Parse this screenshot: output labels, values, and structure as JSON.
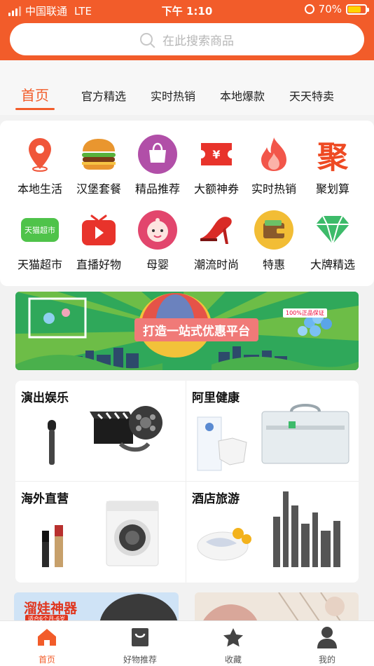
{
  "status_bar": {
    "carrier": "中国联通",
    "network": "LTE",
    "time": "下午 1:10",
    "battery": "70%"
  },
  "search": {
    "placeholder": "在此搜索商品"
  },
  "tabs": [
    {
      "label": "首页",
      "active": true
    },
    {
      "label": "官方精选"
    },
    {
      "label": "实时热销"
    },
    {
      "label": "本地爆款"
    },
    {
      "label": "天天特卖"
    }
  ],
  "categories": [
    {
      "label": "本地生活",
      "icon": "location-pin-icon"
    },
    {
      "label": "汉堡套餐",
      "icon": "burger-icon"
    },
    {
      "label": "精品推荐",
      "icon": "shopping-bag-icon"
    },
    {
      "label": "大额神券",
      "icon": "coupon-icon"
    },
    {
      "label": "实时热销",
      "icon": "flame-icon"
    },
    {
      "label": "聚划算",
      "icon": "juhuasuan-icon"
    },
    {
      "label": "天猫超市",
      "icon": "tmall-supermarket-icon",
      "inner": "天猫超市"
    },
    {
      "label": "直播好物",
      "icon": "live-play-icon"
    },
    {
      "label": "母婴",
      "icon": "baby-icon"
    },
    {
      "label": "潮流时尚",
      "icon": "high-heel-icon"
    },
    {
      "label": "特惠",
      "icon": "wallet-icon"
    },
    {
      "label": "大牌精选",
      "icon": "diamond-icon"
    }
  ],
  "juhuasuan_glyph": "聚",
  "banner": {
    "title": "打造一站式优惠平台",
    "badge": "100%正品保证"
  },
  "features": [
    {
      "title": "演出娱乐"
    },
    {
      "title": "阿里健康"
    },
    {
      "title": "海外直营"
    },
    {
      "title": "酒店旅游"
    }
  ],
  "previews": [
    {
      "title": "溜娃神器",
      "subtitle": "适合6个月-6岁"
    },
    {
      "title": ""
    }
  ],
  "tabbar": [
    {
      "label": "首页",
      "icon": "home-icon",
      "active": true
    },
    {
      "label": "好物推荐",
      "icon": "bag-icon"
    },
    {
      "label": "收藏",
      "icon": "star-icon"
    },
    {
      "label": "我的",
      "icon": "user-icon"
    }
  ],
  "colors": {
    "accent": "#f25c2a"
  }
}
